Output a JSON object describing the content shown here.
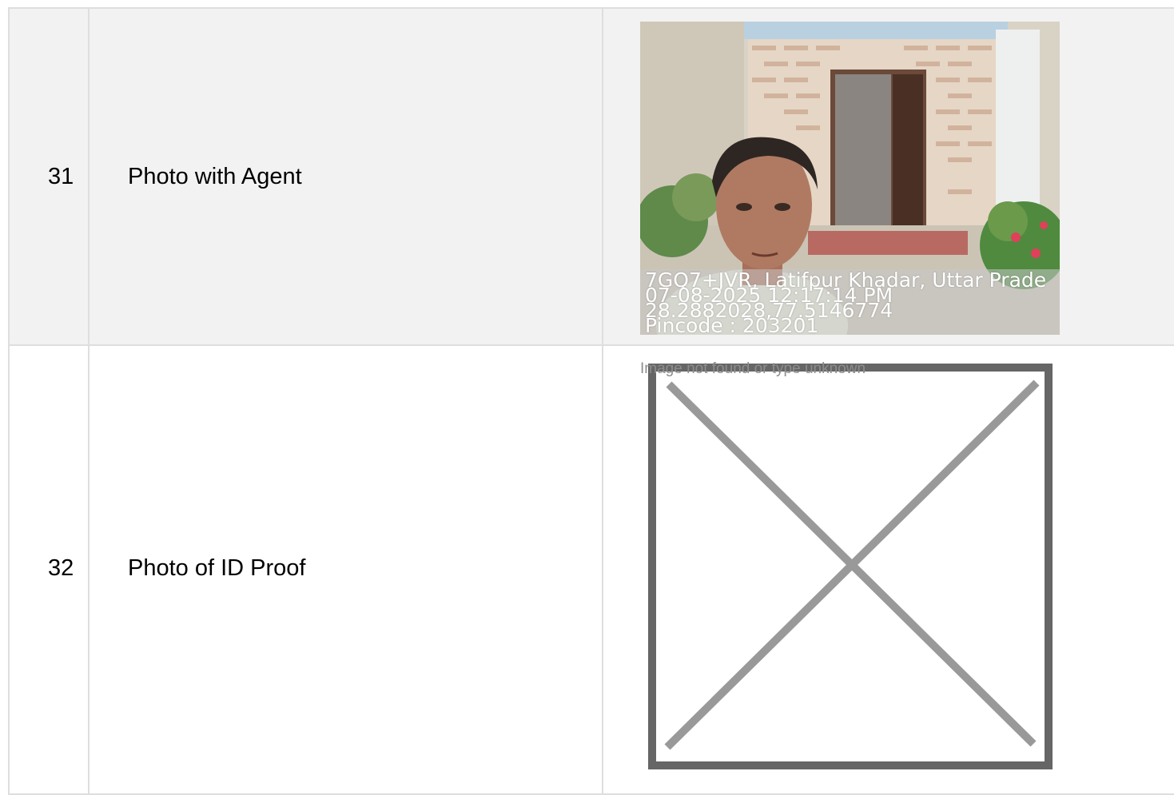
{
  "rows": [
    {
      "number": "31",
      "label": "Photo with Agent",
      "photo": {
        "caption_lines": [
          "7GQ7+JVR, Latifpur Khadar, Uttar Prade",
          "07-08-2025 12:17:14 PM",
          "28.2882028,77.5146774",
          "Pincode : 203201"
        ]
      }
    },
    {
      "number": "32",
      "label": "Photo of ID Proof",
      "missing_image_text": "Image not found or type unknown"
    }
  ],
  "colors": {
    "border": "#dedede",
    "row_shaded": "#f2f2f2",
    "placeholder_frame": "#666666",
    "placeholder_cross": "#999999"
  },
  "icons": {
    "missing_image": "broken-image-cross-icon"
  }
}
